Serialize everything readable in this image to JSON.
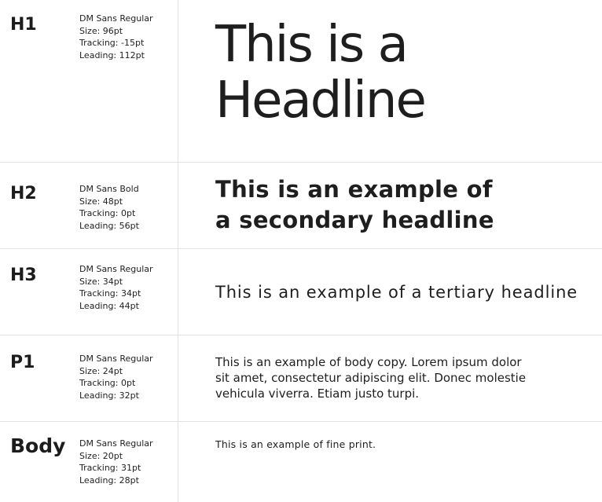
{
  "rows": [
    {
      "tag": "H1",
      "spec": [
        "DM Sans Regular",
        "Size: 96pt",
        "Tracking: -15pt",
        "Leading: 112pt"
      ],
      "sample": [
        "This is a",
        "Headline"
      ]
    },
    {
      "tag": "H2",
      "spec": [
        "DM Sans Bold",
        "Size: 48pt",
        "Tracking: 0pt",
        "Leading: 56pt"
      ],
      "sample": [
        "This is an example of",
        "a secondary headline"
      ]
    },
    {
      "tag": "H3",
      "spec": [
        "DM Sans Regular",
        "Size: 34pt",
        "Tracking: 34pt",
        "Leading: 44pt"
      ],
      "sample": [
        "This is an example of a tertiary headline"
      ]
    },
    {
      "tag": "P1",
      "spec": [
        "DM Sans Regular",
        "Size: 24pt",
        "Tracking: 0pt",
        "Leading: 32pt"
      ],
      "sample": [
        "This is an example of body copy. Lorem ipsum dolor",
        "sit amet, consectetur adipiscing elit. Donec molestie",
        "vehicula viverra. Etiam justo turpi."
      ]
    },
    {
      "tag": "Body",
      "spec": [
        "DM Sans Regular",
        "Size: 20pt",
        "Tracking: 31pt",
        "Leading: 28pt"
      ],
      "sample": [
        "This is an example of fine print."
      ]
    }
  ]
}
